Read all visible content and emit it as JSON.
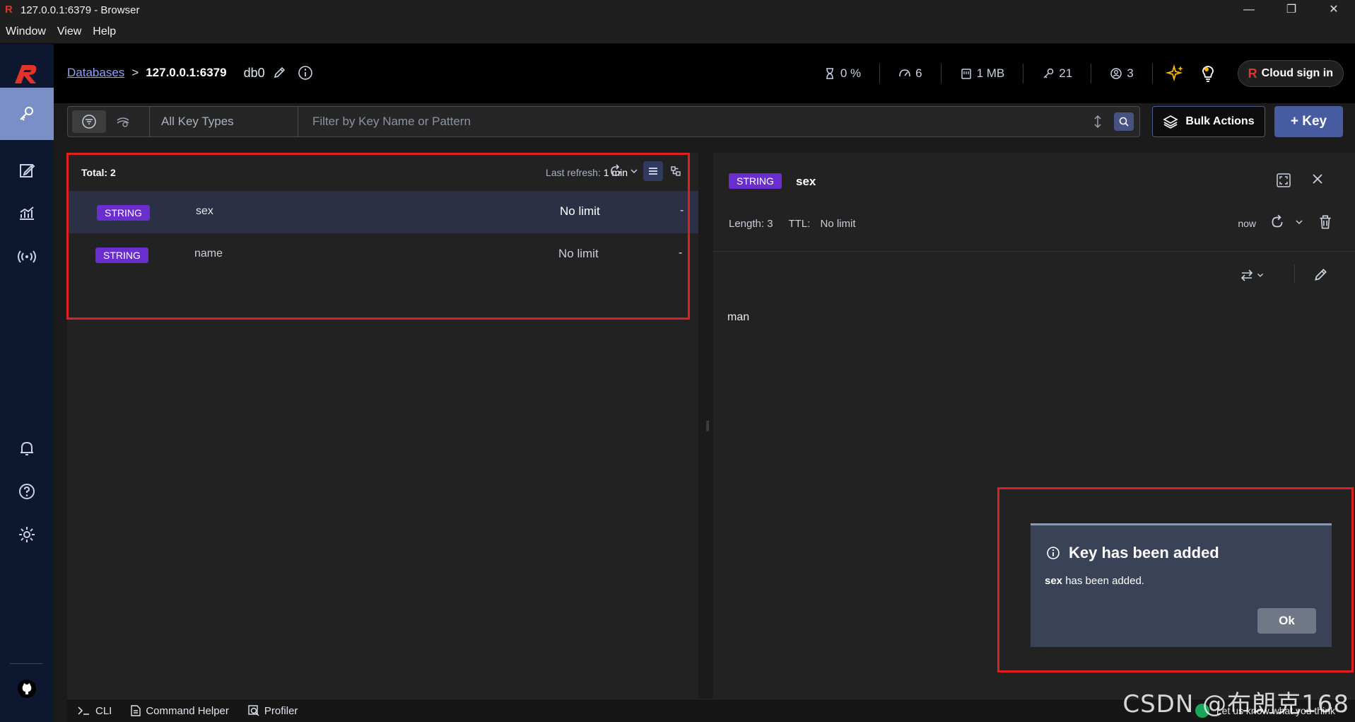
{
  "window": {
    "title": "127.0.0.1:6379 - Browser",
    "controls": [
      "—",
      "❐",
      "✕"
    ]
  },
  "menu": [
    "Window",
    "View",
    "Help"
  ],
  "header": {
    "breadcrumb_link": "Databases",
    "breadcrumb_sep": ">",
    "host": "127.0.0.1:6379",
    "db": "db0",
    "stats": {
      "cpu": "0 %",
      "ops": "6",
      "memory": "1 MB",
      "keys": "21",
      "clients": "3"
    },
    "cloud_label": "Cloud sign in",
    "cloud_glyph": "R"
  },
  "toolbar": {
    "key_types": "All Key Types",
    "filter_placeholder": "Filter by Key Name or Pattern",
    "bulk_label": "Bulk Actions",
    "add_label": "+ Key"
  },
  "key_list": {
    "total": "Total: 2",
    "refresh_label": "Last refresh:",
    "refresh_value": "1 min",
    "rows": [
      {
        "type": "STRING",
        "name": "sex",
        "ttl": "No limit",
        "size": "-"
      },
      {
        "type": "STRING",
        "name": "name",
        "ttl": "No limit",
        "size": "-"
      }
    ]
  },
  "details": {
    "type": "STRING",
    "key": "sex",
    "length": "Length: 3",
    "ttl_label": "TTL:",
    "ttl_value": "No limit",
    "refreshed": "now",
    "value": "man"
  },
  "toast": {
    "title": "Key has been added",
    "key": "sex",
    "message": " has been added.",
    "ok_label": "Ok"
  },
  "bottom": {
    "cli": "CLI",
    "helper": "Command Helper",
    "profiler": "Profiler",
    "feedback": "Let us know what you think"
  },
  "watermark": "CSDN @布朗克168",
  "colors": {
    "accent": "#465ba0",
    "badge": "#6a2ecf",
    "highlight": "#e02020",
    "brand": "#e1342b"
  }
}
